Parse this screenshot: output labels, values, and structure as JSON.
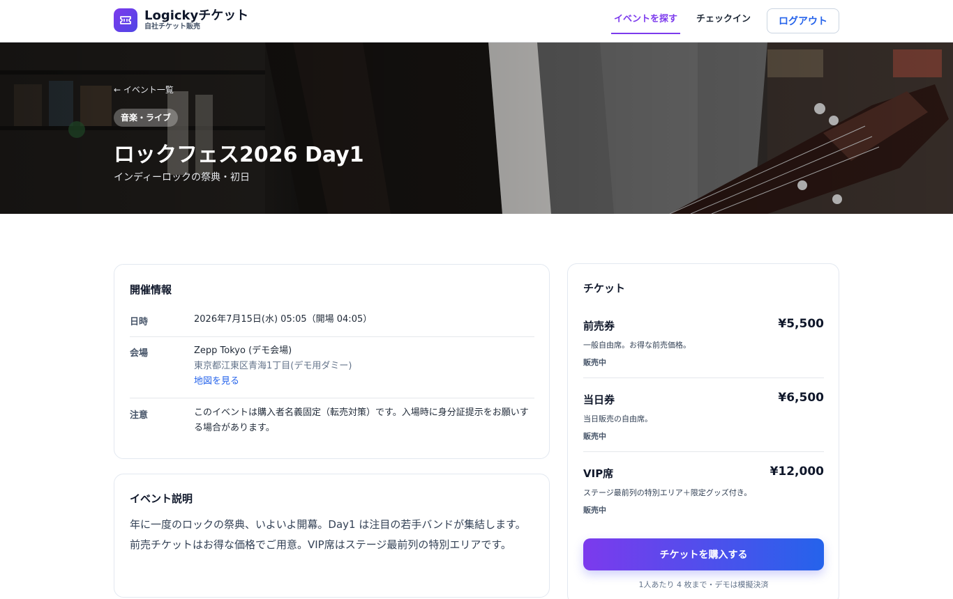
{
  "header": {
    "brand_name": "Logickyチケット",
    "brand_sub": "自社チケット販売",
    "nav": [
      {
        "label": "イベントを探す",
        "active": true
      },
      {
        "label": "チェックイン",
        "active": false
      }
    ],
    "logout_label": "ログアウト"
  },
  "hero": {
    "back_link": "← イベント一覧",
    "category": "音楽・ライブ",
    "title": "ロックフェス2026 Day1",
    "subtitle": "インディーロックの祭典・初日"
  },
  "info": {
    "title": "開催情報",
    "date_label": "日時",
    "date_value": "2026年7月15日(水) 05:05（開場 04:05）",
    "venue_label": "会場",
    "venue_name": "Zepp Tokyo (デモ会場)",
    "venue_address": "東京都江東区青海1丁目(デモ用ダミー)",
    "map_link": "地図を見る",
    "note_label": "注意",
    "note_value": "このイベントは購入者名義固定（転売対策）です。入場時に身分証提示をお願いする場合があります。"
  },
  "description": {
    "title": "イベント説明",
    "text": "年に一度のロックの祭典、いよいよ開幕。Day1 は注目の若手バンドが集結します。前売チケットはお得な価格でご用意。VIP席はステージ最前列の特別エリアです。"
  },
  "tickets": {
    "title": "チケット",
    "items": [
      {
        "name": "前売券",
        "price": "¥5,500",
        "desc": "一般自由席。お得な前売価格。",
        "status": "販売中"
      },
      {
        "name": "当日券",
        "price": "¥6,500",
        "desc": "当日販売の自由席。",
        "status": "販売中"
      },
      {
        "name": "VIP席",
        "price": "¥12,000",
        "desc": "ステージ最前列の特別エリア＋限定グッズ付き。",
        "status": "販売中"
      }
    ],
    "buy_label": "チケットを購入する",
    "buy_note": "1人あたり 4 枚まで・デモは模擬決済"
  }
}
